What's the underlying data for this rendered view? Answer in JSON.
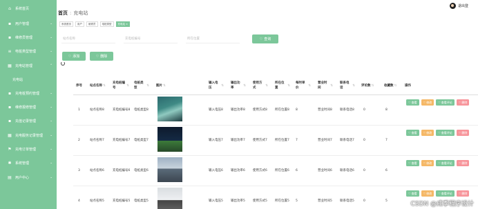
{
  "sidebar": {
    "items": [
      {
        "label": "系统首页",
        "icon": "home-icon",
        "chevron": false
      },
      {
        "label": "用户管理",
        "icon": "user-icon",
        "chevron": true
      },
      {
        "label": "维修员管理",
        "icon": "card-icon",
        "chevron": true
      },
      {
        "label": "电桩类型管理",
        "icon": "list-icon",
        "chevron": true
      },
      {
        "label": "充电站管理",
        "icon": "grid-icon",
        "chevron": true,
        "expanded": true
      }
    ],
    "submenu": [
      {
        "label": "充电站"
      }
    ],
    "items_after": [
      {
        "label": "充电桩预约管理",
        "icon": "card-icon",
        "chevron": true
      },
      {
        "label": "维修报修管理",
        "icon": "card-icon",
        "chevron": true
      },
      {
        "label": "充值记录管理",
        "icon": "card-icon",
        "chevron": true
      },
      {
        "label": "充电服务记录管理",
        "icon": "grid-icon",
        "chevron": true
      },
      {
        "label": "充电订单管理",
        "icon": "flag-icon",
        "chevron": true
      },
      {
        "label": "系统管理",
        "icon": "gear-icon",
        "chevron": true
      },
      {
        "label": "用户中心",
        "icon": "doc-icon",
        "chevron": true
      }
    ]
  },
  "breadcrumb": {
    "home": "首页",
    "sep": ":",
    "current": "充电站"
  },
  "user": {
    "name": "退出登"
  },
  "tags": [
    "系统首页",
    "用户",
    "维修员",
    "电桩类型",
    "充电站 ×"
  ],
  "search": {
    "field1_placeholder": "站点名称",
    "field2_placeholder": "充电桩编号",
    "field3_placeholder": "所在位置",
    "button": "查询"
  },
  "actions": {
    "add": "添加",
    "delete": "删除"
  },
  "table": {
    "headers": [
      "序号",
      "站点名称",
      "充电桩编号",
      "电桩类型",
      "图片",
      "输入电压",
      "输出功率",
      "使用方式",
      "所在位置",
      "每时单价",
      "营业时间",
      "联系电话",
      "评论数",
      "收藏数",
      "操作"
    ],
    "rows": [
      {
        "idx": "1",
        "name": "站点名称8",
        "code": "充电桩编号8",
        "type": "电桩类型8",
        "voltage": "输入电压8",
        "power": "输出功率8",
        "usage": "使用方式8",
        "location": "所在位置8",
        "price": "8",
        "hours": "营业时间8",
        "phone": "联系电话8",
        "comments": "0",
        "favs": "8"
      },
      {
        "idx": "2",
        "name": "站点名称7",
        "code": "充电桩编号7",
        "type": "电桩类型7",
        "voltage": "输入电压7",
        "power": "输出功率7",
        "usage": "使用方式7",
        "location": "所在位置7",
        "price": "7",
        "hours": "营业时间7",
        "phone": "联系电话7",
        "comments": "0",
        "favs": "7"
      },
      {
        "idx": "3",
        "name": "站点名称6",
        "code": "充电桩编号6",
        "type": "电桩类型6",
        "voltage": "输入电压6",
        "power": "输出功率6",
        "usage": "使用方式6",
        "location": "所在位置6",
        "price": "6",
        "hours": "营业时间6",
        "phone": "联系电话6",
        "comments": "0",
        "favs": "6"
      },
      {
        "idx": "4",
        "name": "站点名称5",
        "code": "充电桩编号5",
        "type": "电桩类型5",
        "voltage": "输入电压5",
        "power": "输出功率5",
        "usage": "使用方式5",
        "location": "所在位置5",
        "price": "5",
        "hours": "营业时间5",
        "phone": "联系电话5",
        "comments": "0",
        "favs": "5"
      }
    ],
    "row_buttons": {
      "view": "查看",
      "edit": "修改",
      "view_comments": "查看评论",
      "delete": "删除"
    }
  },
  "watermark": "CSDN @成季程序设计",
  "colors": {
    "accent": "#7cc79a",
    "warning": "#f5b867",
    "danger": "#f7949a"
  }
}
